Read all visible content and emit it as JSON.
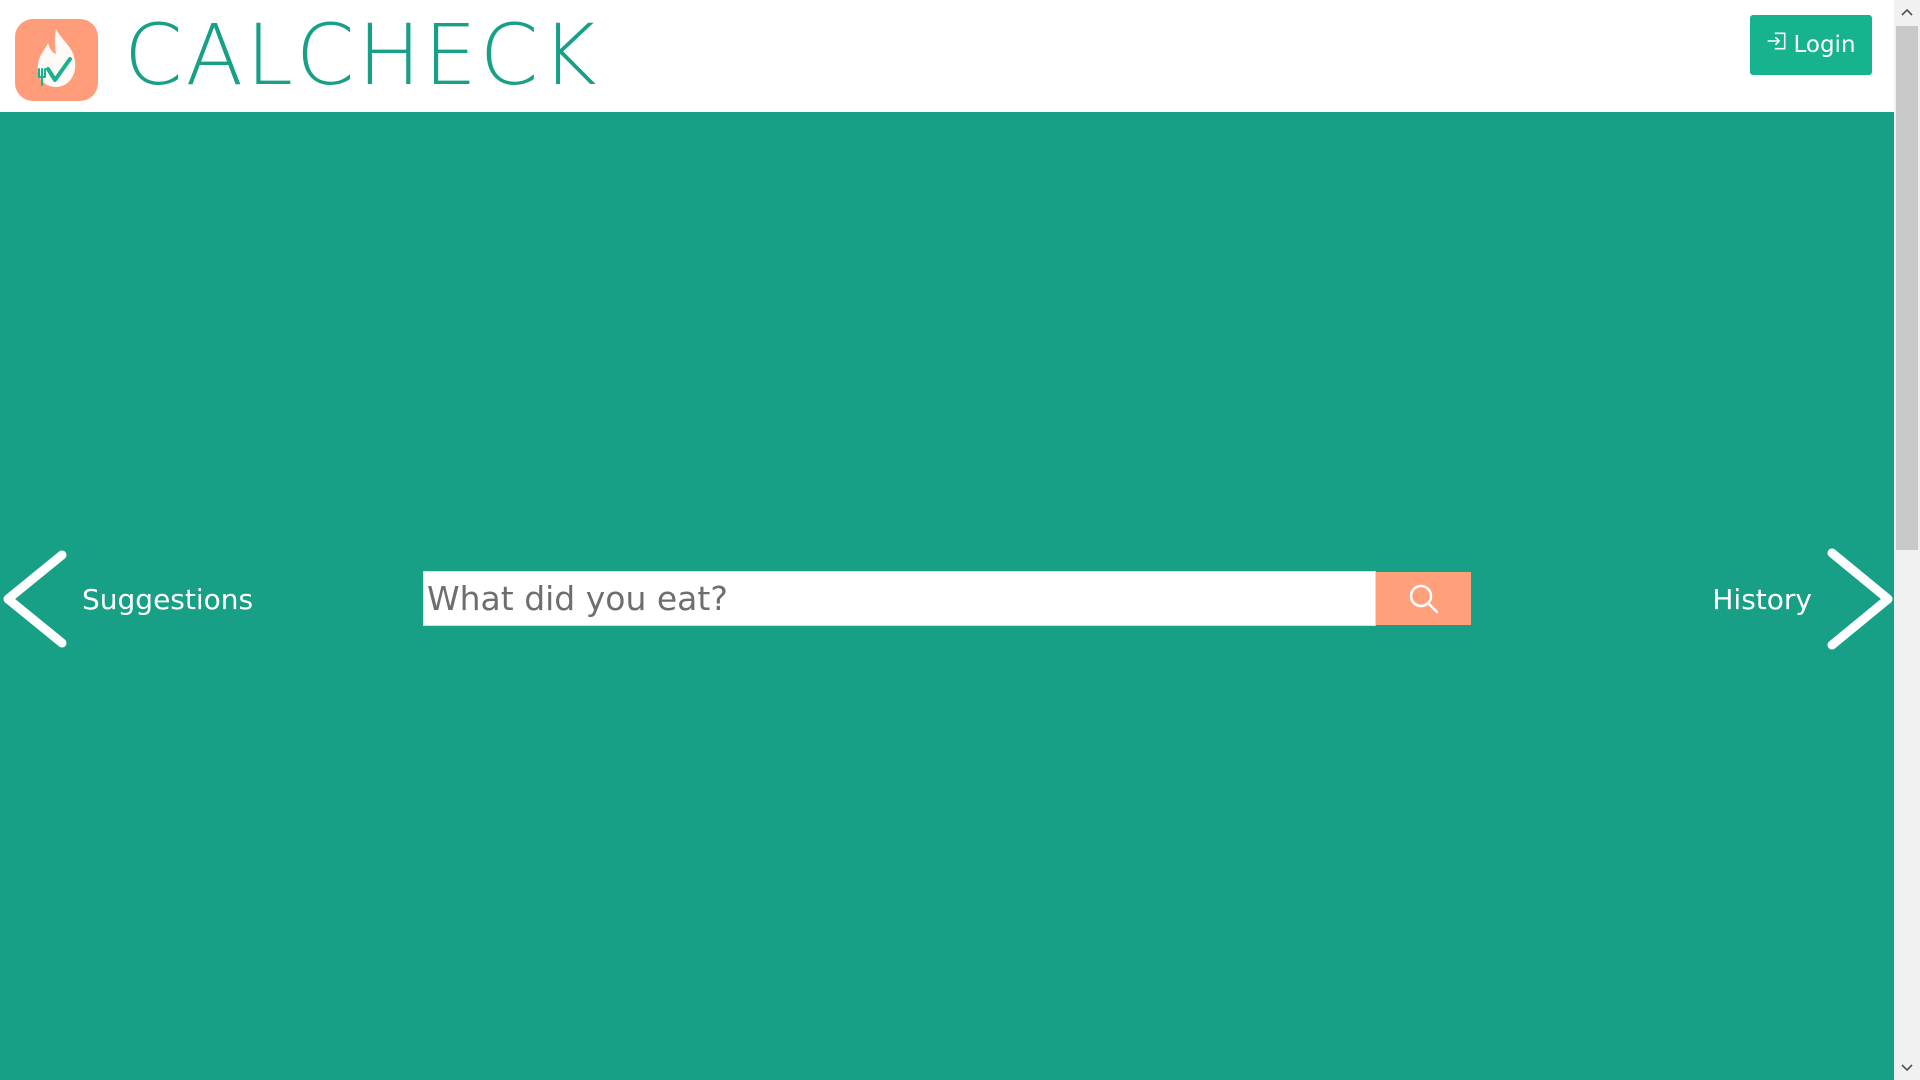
{
  "header": {
    "brand": "CALCHECK",
    "logo_icon": "flame-check-icon",
    "login_label": "Login",
    "login_icon": "sign-in-icon"
  },
  "main": {
    "prev_label": "Suggestions",
    "next_label": "History",
    "search": {
      "placeholder": "What did you eat?",
      "value": "",
      "button_icon": "search-icon"
    }
  },
  "colors": {
    "brand": "#17a086",
    "login_button": "#17b38f",
    "search_button": "#ffa07a",
    "logo_bg": "#ff9d7a"
  }
}
